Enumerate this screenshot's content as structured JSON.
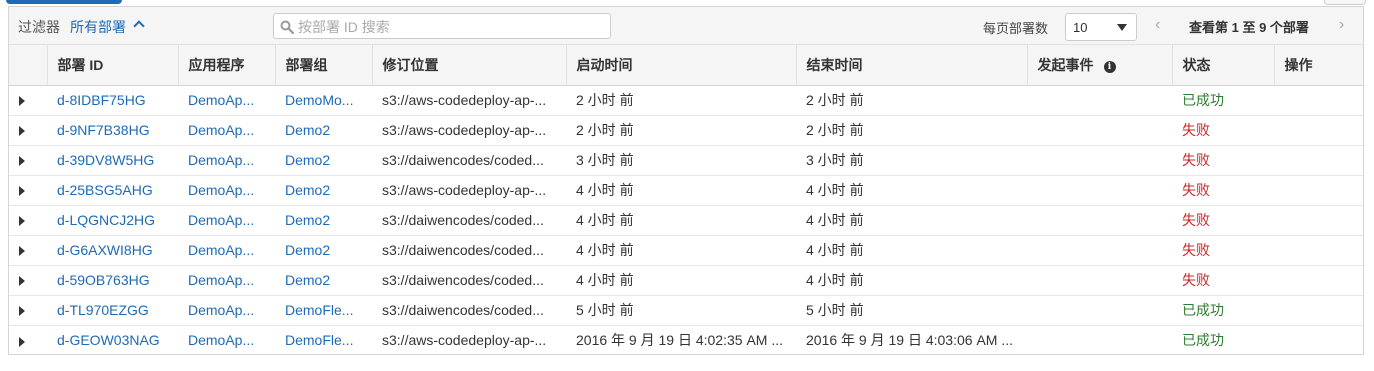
{
  "toolbar": {
    "filter_label": "过滤器",
    "filter_value": "所有部署",
    "search_placeholder": "按部署 ID 搜索",
    "per_page_label": "每页部署数",
    "per_page_value": "10",
    "pager_text": "查看第 1 至 9 个部署"
  },
  "columns": [
    "部署 ID",
    "应用程序",
    "部署组",
    "修订位置",
    "启动时间",
    "结束时间",
    "发起事件",
    "状态",
    "操作"
  ],
  "rows": [
    {
      "id": "d-8IDBF75HG",
      "app": "DemoAp...",
      "group": "DemoMo...",
      "revision": "s3://aws-codedeploy-ap-...",
      "start": "2 小时 前",
      "end": "2 小时 前",
      "event": "",
      "status": "已成功",
      "status_type": "success",
      "action": ""
    },
    {
      "id": "d-9NF7B38HG",
      "app": "DemoAp...",
      "group": "Demo2",
      "revision": "s3://aws-codedeploy-ap-...",
      "start": "2 小时 前",
      "end": "2 小时 前",
      "event": "",
      "status": "失败",
      "status_type": "failed",
      "action": ""
    },
    {
      "id": "d-39DV8W5HG",
      "app": "DemoAp...",
      "group": "Demo2",
      "revision": "s3://daiwencodes/coded...",
      "start": "3 小时 前",
      "end": "3 小时 前",
      "event": "",
      "status": "失败",
      "status_type": "failed",
      "action": ""
    },
    {
      "id": "d-25BSG5AHG",
      "app": "DemoAp...",
      "group": "Demo2",
      "revision": "s3://aws-codedeploy-ap-...",
      "start": "4 小时 前",
      "end": "4 小时 前",
      "event": "",
      "status": "失败",
      "status_type": "failed",
      "action": ""
    },
    {
      "id": "d-LQGNCJ2HG",
      "app": "DemoAp...",
      "group": "Demo2",
      "revision": "s3://daiwencodes/coded...",
      "start": "4 小时 前",
      "end": "4 小时 前",
      "event": "",
      "status": "失败",
      "status_type": "failed",
      "action": ""
    },
    {
      "id": "d-G6AXWI8HG",
      "app": "DemoAp...",
      "group": "Demo2",
      "revision": "s3://daiwencodes/coded...",
      "start": "4 小时 前",
      "end": "4 小时 前",
      "event": "",
      "status": "失败",
      "status_type": "failed",
      "action": ""
    },
    {
      "id": "d-59OB763HG",
      "app": "DemoAp...",
      "group": "Demo2",
      "revision": "s3://daiwencodes/coded...",
      "start": "4 小时 前",
      "end": "4 小时 前",
      "event": "",
      "status": "失败",
      "status_type": "failed",
      "action": ""
    },
    {
      "id": "d-TL970EZGG",
      "app": "DemoAp...",
      "group": "DemoFle...",
      "revision": "s3://daiwencodes/coded...",
      "start": "5 小时 前",
      "end": "5 小时 前",
      "event": "",
      "status": "已成功",
      "status_type": "success",
      "action": ""
    },
    {
      "id": "d-GEOW03NAG",
      "app": "DemoAp...",
      "group": "DemoFle...",
      "revision": "s3://aws-codedeploy-ap-...",
      "start": "2016 年 9 月 19 日 4:02:35 AM ...",
      "end": "2016 年 9 月 19 日 4:03:06 AM ...",
      "event": "",
      "status": "已成功",
      "status_type": "success",
      "action": ""
    }
  ],
  "colors": {
    "link": "#1f6ab4",
    "success": "#2e7d32",
    "failed": "#c62828"
  }
}
